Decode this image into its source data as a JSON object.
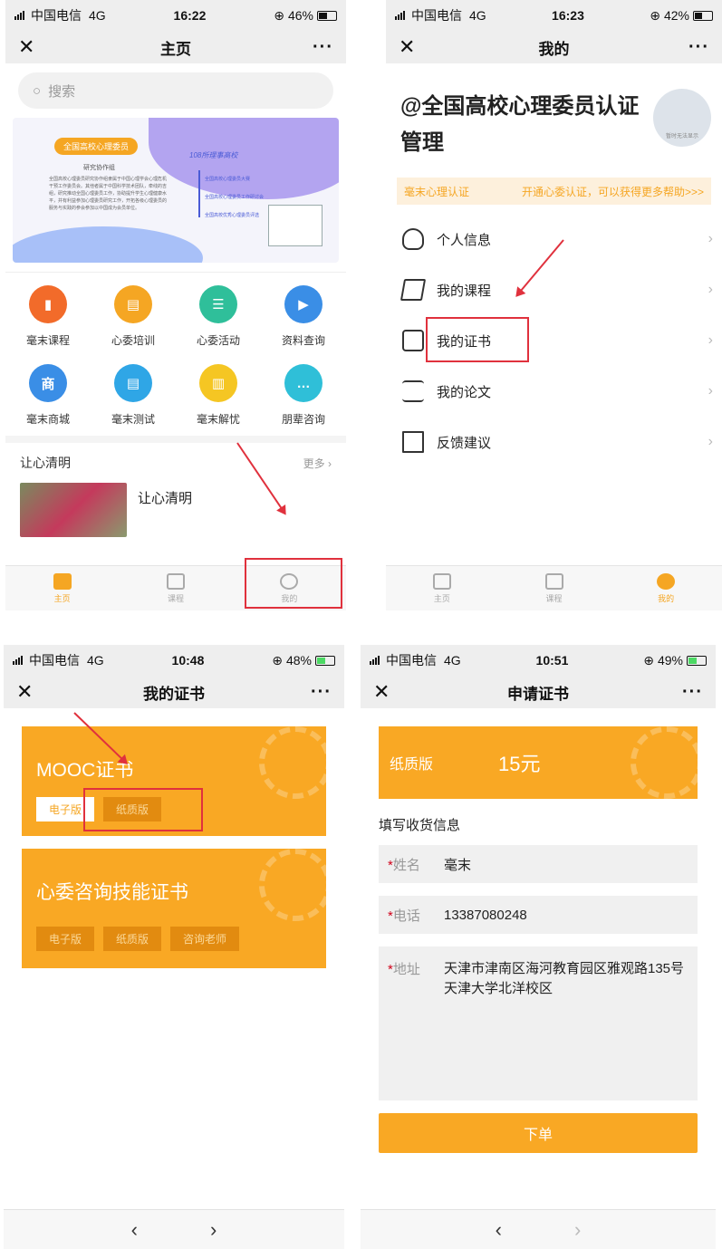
{
  "p1": {
    "status": {
      "carrier": "中国电信",
      "net": "4G",
      "time": "16:22",
      "battery": "46%"
    },
    "nav_title": "主页",
    "search_placeholder": "搜索",
    "banner": {
      "tag": "全国高校心理委员",
      "subtitle": "研究协作组",
      "text": "全国高校心理委员研究协作组隶属于中国心理学会心理危机干预工作委员会。其他者属于中国科学技术团队，牵线的吉组，研究推动全国心理委员工作，协助提升学生心理健康水平，并有利益参加心理委员研究工作，开拓各级心理委员的服务与实践的参会参加以中国成为会员单位。",
      "right_title": "108所理事高校",
      "items": [
        "全国高校心理委员大赛",
        "全国高校心理委员工作研讨会",
        "全国高校优秀心理委员评选"
      ]
    },
    "grid": [
      {
        "label": "毫末课程",
        "color": "#f26b2a",
        "glyph": "▮"
      },
      {
        "label": "心委培训",
        "color": "#f5a623",
        "glyph": "▤"
      },
      {
        "label": "心委活动",
        "color": "#2fbf9a",
        "glyph": "☰"
      },
      {
        "label": "资料查询",
        "color": "#3a8ee6",
        "glyph": "▶"
      },
      {
        "label": "毫末商城",
        "color": "#3a8ee6",
        "glyph": "商"
      },
      {
        "label": "毫末测试",
        "color": "#2fa6e6",
        "glyph": "▤"
      },
      {
        "label": "毫末解忧",
        "color": "#f5c623",
        "glyph": "▥"
      },
      {
        "label": "朋辈咨询",
        "color": "#2fbfd8",
        "glyph": "…"
      }
    ],
    "section_title": "让心清明",
    "section_more": "更多",
    "article_title": "让心清明",
    "tabs": [
      "主页",
      "课程",
      "我的"
    ]
  },
  "p2": {
    "status": {
      "carrier": "中国电信",
      "net": "4G",
      "time": "16:23",
      "battery": "42%"
    },
    "nav_title": "我的",
    "heading": "@全国高校心理委员认证管理",
    "avatar_text": "暂时无法显示",
    "cert_label": "毫末心理认证",
    "cert_promo": "开通心委认证，可以获得更多帮助>>>",
    "menu": [
      "个人信息",
      "我的课程",
      "我的证书",
      "我的论文",
      "反馈建议"
    ],
    "tabs": [
      "主页",
      "课程",
      "我的"
    ]
  },
  "p3": {
    "status": {
      "carrier": "中国电信",
      "net": "4G",
      "time": "10:48",
      "battery": "48%"
    },
    "nav_title": "我的证书",
    "cards": [
      {
        "name": "MOOC证书",
        "buttons": [
          "电子版",
          "纸质版"
        ]
      },
      {
        "name": "心委咨询技能证书",
        "buttons": [
          "电子版",
          "纸质版",
          "咨询老师"
        ]
      }
    ],
    "back": "‹",
    "forward": "›"
  },
  "p4": {
    "status": {
      "carrier": "中国电信",
      "net": "4G",
      "time": "10:51",
      "battery": "49%"
    },
    "nav_title": "申请证书",
    "paper_label": "纸质版",
    "price": "15元",
    "fill_heading": "填写收货信息",
    "name_label": "姓名",
    "name_value": "毫末",
    "phone_label": "电话",
    "phone_value": "13387080248",
    "addr_label": "地址",
    "addr_value": "天津市津南区海河教育园区雅观路135号天津大学北洋校区",
    "order_button": "下单",
    "back": "‹",
    "forward": "›"
  }
}
